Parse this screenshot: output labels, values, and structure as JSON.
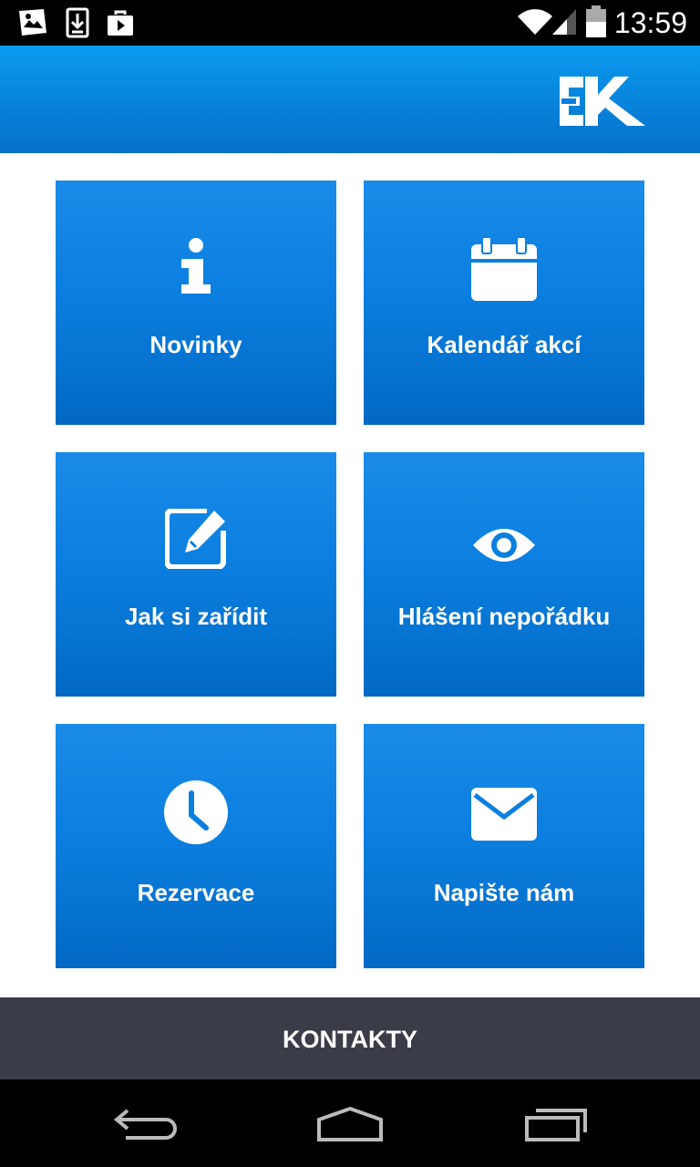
{
  "status_bar": {
    "time": "13:59"
  },
  "tiles": [
    {
      "label": "Novinky",
      "icon": "info-icon"
    },
    {
      "label": "Kalendář akcí",
      "icon": "calendar-icon"
    },
    {
      "label": "Jak si zařídit",
      "icon": "edit-icon"
    },
    {
      "label": "Hlášení nepořádku",
      "icon": "eye-icon"
    },
    {
      "label": "Rezervace",
      "icon": "clock-icon"
    },
    {
      "label": "Napište nám",
      "icon": "mail-icon"
    }
  ],
  "footer": {
    "label": "KONTAKTY"
  },
  "colors": {
    "accent": "#0b7fe0",
    "appbar": "#0a9af0",
    "footer": "#3a3d48"
  }
}
